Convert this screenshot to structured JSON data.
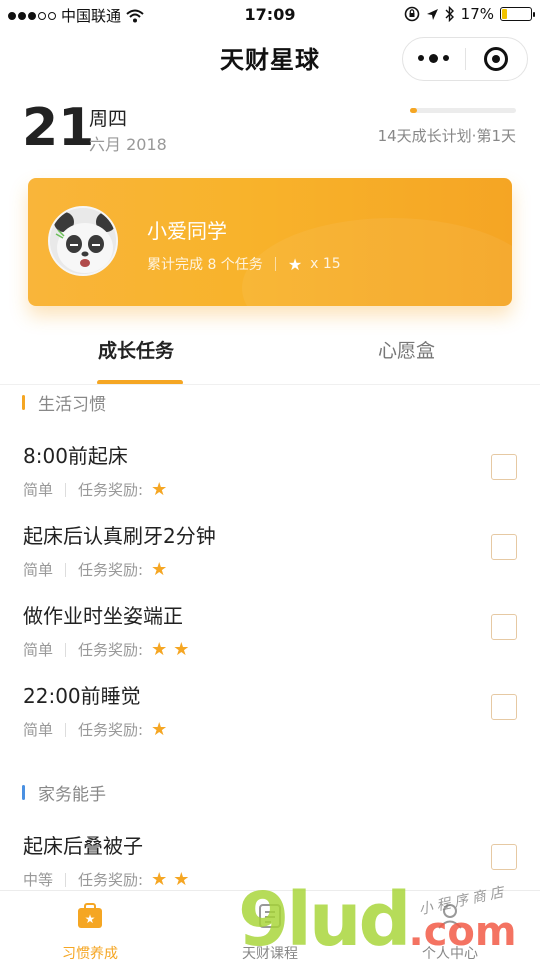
{
  "status_bar": {
    "carrier": "中国联通",
    "time": "17:09",
    "battery": "17%"
  },
  "nav": {
    "title": "天财星球"
  },
  "date": {
    "day": "21",
    "weekday": "周四",
    "month_year": "六月 2018",
    "plan": "14天成长计划·第1天",
    "plan_progress": 0.07
  },
  "profile": {
    "name": "小爱同学",
    "completed": "累计完成 8 个任务",
    "stars": "x 15"
  },
  "tabs": [
    {
      "label": "成长任务",
      "active": true
    },
    {
      "label": "心愿盒",
      "active": false
    }
  ],
  "sections": [
    {
      "title": "生活习惯",
      "color": "#f5a623",
      "tasks": [
        {
          "title": "8:00前起床",
          "level": "简单",
          "reward_label": "任务奖励:",
          "stars": 1
        },
        {
          "title": "起床后认真刷牙2分钟",
          "level": "简单",
          "reward_label": "任务奖励:",
          "stars": 1
        },
        {
          "title": "做作业时坐姿端正",
          "level": "简单",
          "reward_label": "任务奖励:",
          "stars": 2
        },
        {
          "title": "22:00前睡觉",
          "level": "简单",
          "reward_label": "任务奖励:",
          "stars": 1
        }
      ]
    },
    {
      "title": "家务能手",
      "color": "#4a90e2",
      "tasks": [
        {
          "title": "起床后叠被子",
          "level": "中等",
          "reward_label": "任务奖励:",
          "stars": 2
        }
      ]
    }
  ],
  "tabbar": [
    {
      "label": "习惯养成",
      "icon": "briefcase-star-icon",
      "active": true
    },
    {
      "label": "天财课程",
      "icon": "course-icon",
      "active": false
    },
    {
      "label": "个人中心",
      "icon": "person-icon",
      "active": false
    }
  ],
  "watermark": {
    "brand": "9lud",
    "tld": ".com",
    "slogan": "小程序商店"
  },
  "colors": {
    "accent": "#f5a623",
    "section_blue": "#4a90e2"
  }
}
